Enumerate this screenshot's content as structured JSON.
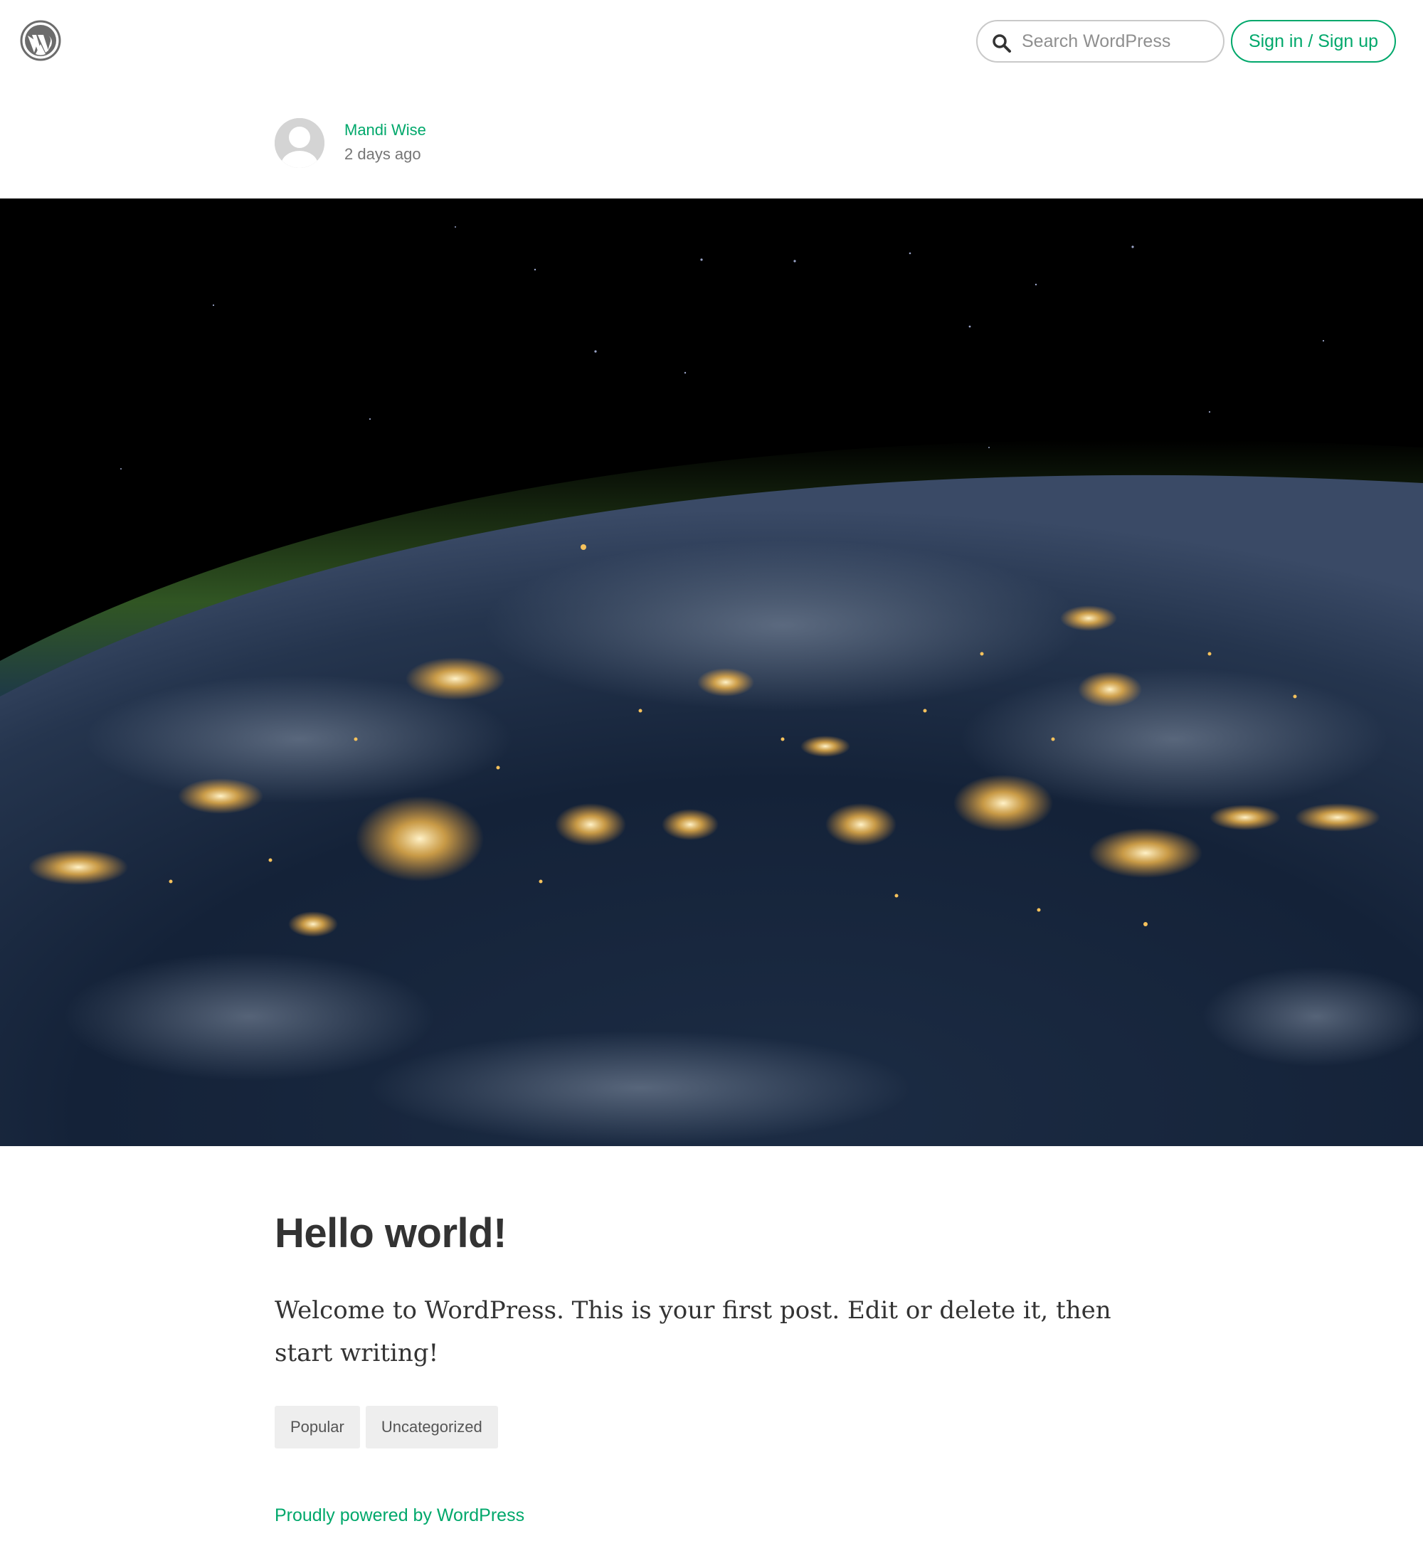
{
  "header": {
    "logo_icon": "wordpress-logo-icon",
    "search": {
      "icon": "search-icon",
      "placeholder": "Search WordPress",
      "value": ""
    },
    "signin_label": "Sign in / Sign up"
  },
  "post": {
    "author": "Mandi Wise",
    "date": "2 days ago",
    "avatar_icon": "default-avatar-icon",
    "title": "Hello world!",
    "body": "Welcome to WordPress. This is your first post. Edit or delete it, then start writing!",
    "tags": [
      "Popular",
      "Uncategorized"
    ]
  },
  "footer": {
    "powered_by": "Proudly powered by WordPress"
  },
  "colors": {
    "accent": "#00a86b",
    "text": "#333333",
    "muted": "#767676",
    "tag_bg": "#eeeeee"
  }
}
